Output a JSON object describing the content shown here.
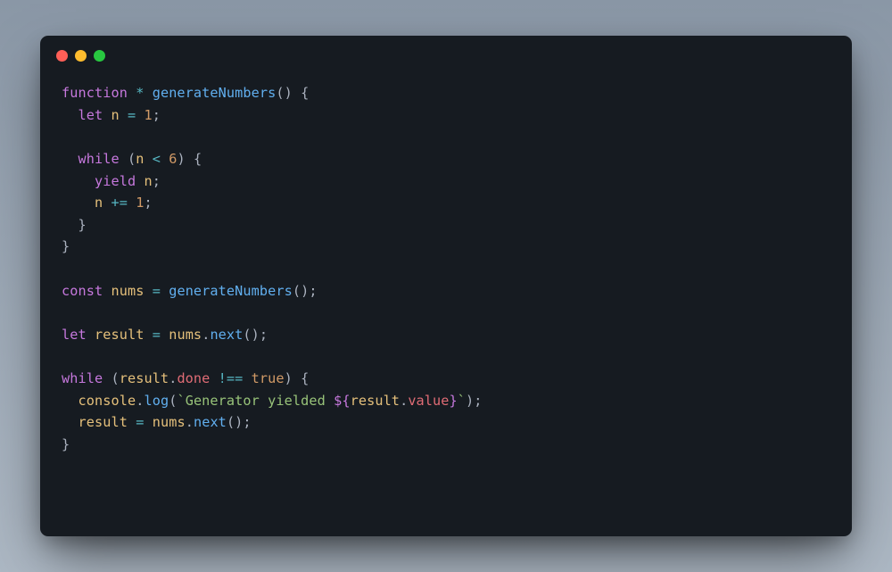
{
  "window": {
    "traffic_light_colors": {
      "close": "#ff5f57",
      "minimize": "#febc2e",
      "zoom": "#28c840"
    },
    "bg": "#161b21"
  },
  "theme": {
    "keyword": "#c678dd",
    "operator": "#56b6c2",
    "function": "#61afef",
    "identifier": "#e5c07b",
    "property": "#e06c75",
    "number": "#d19a66",
    "boolean": "#d19a66",
    "punctuation": "#abb2bf",
    "string": "#98c379",
    "template_delim": "#c678dd"
  },
  "code": {
    "lines": [
      [
        {
          "t": "function",
          "c": "kw-decl"
        },
        {
          "t": " ",
          "c": "punc"
        },
        {
          "t": "*",
          "c": "op"
        },
        {
          "t": " ",
          "c": "punc"
        },
        {
          "t": "generateNumbers",
          "c": "fn-def"
        },
        {
          "t": "()",
          "c": "punc"
        },
        {
          "t": " ",
          "c": "punc"
        },
        {
          "t": "{",
          "c": "punc"
        }
      ],
      [
        {
          "t": "  ",
          "c": "punc"
        },
        {
          "t": "let",
          "c": "kw-decl"
        },
        {
          "t": " ",
          "c": "punc"
        },
        {
          "t": "n",
          "c": "ident"
        },
        {
          "t": " ",
          "c": "punc"
        },
        {
          "t": "=",
          "c": "op"
        },
        {
          "t": " ",
          "c": "punc"
        },
        {
          "t": "1",
          "c": "num"
        },
        {
          "t": ";",
          "c": "punc"
        }
      ],
      [],
      [
        {
          "t": "  ",
          "c": "punc"
        },
        {
          "t": "while",
          "c": "kw-decl"
        },
        {
          "t": " (",
          "c": "punc"
        },
        {
          "t": "n",
          "c": "ident"
        },
        {
          "t": " ",
          "c": "punc"
        },
        {
          "t": "<",
          "c": "op"
        },
        {
          "t": " ",
          "c": "punc"
        },
        {
          "t": "6",
          "c": "num"
        },
        {
          "t": ") ",
          "c": "punc"
        },
        {
          "t": "{",
          "c": "punc"
        }
      ],
      [
        {
          "t": "    ",
          "c": "punc"
        },
        {
          "t": "yield",
          "c": "kw-flow"
        },
        {
          "t": " ",
          "c": "punc"
        },
        {
          "t": "n",
          "c": "ident"
        },
        {
          "t": ";",
          "c": "punc"
        }
      ],
      [
        {
          "t": "    ",
          "c": "punc"
        },
        {
          "t": "n",
          "c": "ident"
        },
        {
          "t": " ",
          "c": "punc"
        },
        {
          "t": "+=",
          "c": "op"
        },
        {
          "t": " ",
          "c": "punc"
        },
        {
          "t": "1",
          "c": "num"
        },
        {
          "t": ";",
          "c": "punc"
        }
      ],
      [
        {
          "t": "  ",
          "c": "punc"
        },
        {
          "t": "}",
          "c": "punc"
        }
      ],
      [
        {
          "t": "}",
          "c": "punc"
        }
      ],
      [],
      [
        {
          "t": "const",
          "c": "kw-decl"
        },
        {
          "t": " ",
          "c": "punc"
        },
        {
          "t": "nums",
          "c": "ident"
        },
        {
          "t": " ",
          "c": "punc"
        },
        {
          "t": "=",
          "c": "op"
        },
        {
          "t": " ",
          "c": "punc"
        },
        {
          "t": "generateNumbers",
          "c": "fn-call"
        },
        {
          "t": "();",
          "c": "punc"
        }
      ],
      [],
      [
        {
          "t": "let",
          "c": "kw-decl"
        },
        {
          "t": " ",
          "c": "punc"
        },
        {
          "t": "result",
          "c": "ident"
        },
        {
          "t": " ",
          "c": "punc"
        },
        {
          "t": "=",
          "c": "op"
        },
        {
          "t": " ",
          "c": "punc"
        },
        {
          "t": "nums",
          "c": "ident"
        },
        {
          "t": ".",
          "c": "punc"
        },
        {
          "t": "next",
          "c": "fn-call"
        },
        {
          "t": "();",
          "c": "punc"
        }
      ],
      [],
      [
        {
          "t": "while",
          "c": "kw-decl"
        },
        {
          "t": " (",
          "c": "punc"
        },
        {
          "t": "result",
          "c": "ident"
        },
        {
          "t": ".",
          "c": "punc"
        },
        {
          "t": "done",
          "c": "prop"
        },
        {
          "t": " ",
          "c": "punc"
        },
        {
          "t": "!==",
          "c": "op"
        },
        {
          "t": " ",
          "c": "punc"
        },
        {
          "t": "true",
          "c": "bool"
        },
        {
          "t": ") ",
          "c": "punc"
        },
        {
          "t": "{",
          "c": "punc"
        }
      ],
      [
        {
          "t": "  ",
          "c": "punc"
        },
        {
          "t": "console",
          "c": "ident"
        },
        {
          "t": ".",
          "c": "punc"
        },
        {
          "t": "log",
          "c": "fn-call"
        },
        {
          "t": "(",
          "c": "punc"
        },
        {
          "t": "`Generator yielded ",
          "c": "str"
        },
        {
          "t": "${",
          "c": "tpl"
        },
        {
          "t": "result",
          "c": "ident"
        },
        {
          "t": ".",
          "c": "punc"
        },
        {
          "t": "value",
          "c": "prop"
        },
        {
          "t": "}",
          "c": "tpl"
        },
        {
          "t": "`",
          "c": "str"
        },
        {
          "t": ");",
          "c": "punc"
        }
      ],
      [
        {
          "t": "  ",
          "c": "punc"
        },
        {
          "t": "result",
          "c": "ident"
        },
        {
          "t": " ",
          "c": "punc"
        },
        {
          "t": "=",
          "c": "op"
        },
        {
          "t": " ",
          "c": "punc"
        },
        {
          "t": "nums",
          "c": "ident"
        },
        {
          "t": ".",
          "c": "punc"
        },
        {
          "t": "next",
          "c": "fn-call"
        },
        {
          "t": "();",
          "c": "punc"
        }
      ],
      [
        {
          "t": "}",
          "c": "punc"
        }
      ]
    ]
  }
}
